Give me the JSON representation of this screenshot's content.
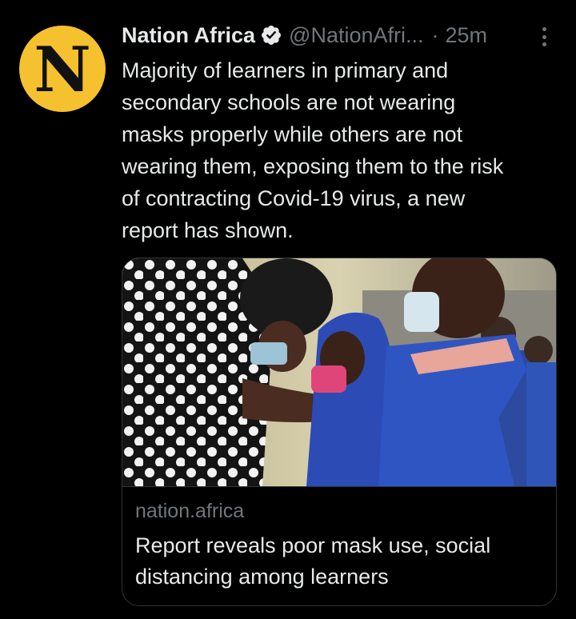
{
  "tweet": {
    "avatar_letter": "N",
    "display_name": "Nation Africa",
    "handle": "@NationAfri...",
    "separator": "·",
    "time": "25m",
    "text": "Majority of learners in primary and\nsecondary schools are not wearing\nmasks properly while others are not\nwearing them, exposing them to the risk\nof contracting Covid-19 virus, a new\nreport has shown."
  },
  "card": {
    "domain": "nation.africa",
    "title": "Report reveals poor mask use, social distancing among learners"
  },
  "icons": {
    "verified": "verified-badge-icon",
    "more": "more-options-icon"
  },
  "colors": {
    "background": "#000000",
    "text_primary": "#e7e9ea",
    "text_secondary": "#71767b",
    "avatar_bg": "#f6c12e",
    "border": "#2f3336"
  }
}
